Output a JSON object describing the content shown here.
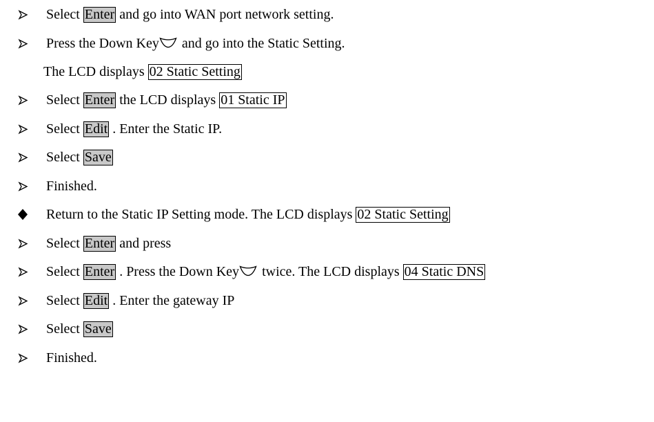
{
  "icons": {
    "arrow_bullet": "arrow-bullet-icon",
    "diamond_bullet": "diamond-bullet-icon",
    "down_key": "down-key-icon"
  },
  "colors": {
    "key_background": "#c8c8c8",
    "lcd_background": "#ffffff",
    "text": "#000000"
  },
  "steps": [
    {
      "a": "Select ",
      "key": "Enter",
      "b": " and go into WAN port network setting."
    },
    {
      "a": "Press the Down Key",
      "b": " and go into the Static Setting."
    },
    {
      "a": "The LCD displays ",
      "lcd": "02 Static Setting"
    },
    {
      "a": "Select ",
      "key": "Enter",
      "b": " the LCD displays ",
      "lcd": "01 Static IP"
    },
    {
      "a": "Select ",
      "key": "Edit",
      "b": " . Enter the Static IP."
    },
    {
      "a": "Select ",
      "key": "Save"
    },
    {
      "a": "Finished."
    },
    {
      "a": "Return to the Static IP Setting mode. The LCD displays ",
      "lcd": "02 Static Setting"
    },
    {
      "a": "Select ",
      "key": "Enter",
      "b": " and press"
    },
    {
      "a": "Select ",
      "key": "Enter",
      "b": " . Press the Down Key",
      "c": " twice. The LCD displays ",
      "lcd": "04 Static DNS"
    },
    {
      "a": "Select ",
      "key": "Edit",
      "b": " . Enter the gateway IP"
    },
    {
      "a": "Select ",
      "key": "Save"
    },
    {
      "a": "Finished."
    }
  ]
}
